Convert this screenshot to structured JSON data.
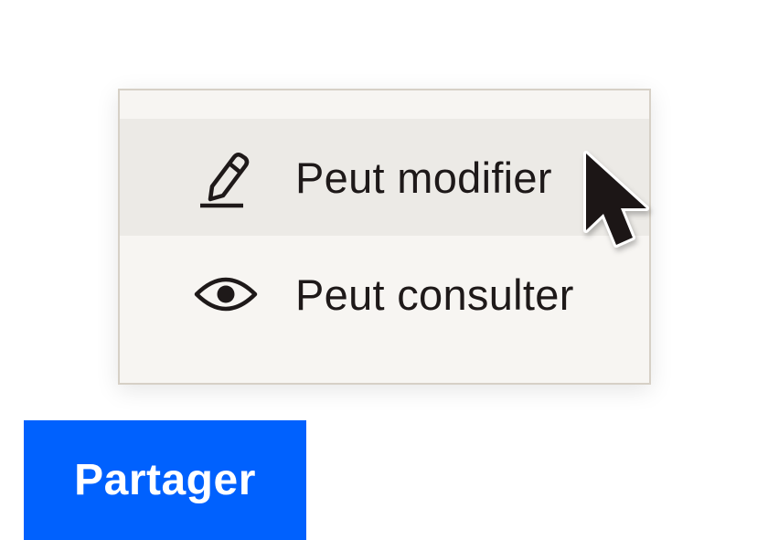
{
  "menu": {
    "items": [
      {
        "label": "Peut modifier",
        "icon": "pencil-icon",
        "state": "hovered"
      },
      {
        "label": "Peut consulter",
        "icon": "eye-icon"
      }
    ]
  },
  "share": {
    "label": "Partager",
    "color": "#0061fe"
  },
  "colors": {
    "menu_background": "#f7f5f2",
    "hover_background": "#eceae6",
    "text": "#1e1919"
  }
}
